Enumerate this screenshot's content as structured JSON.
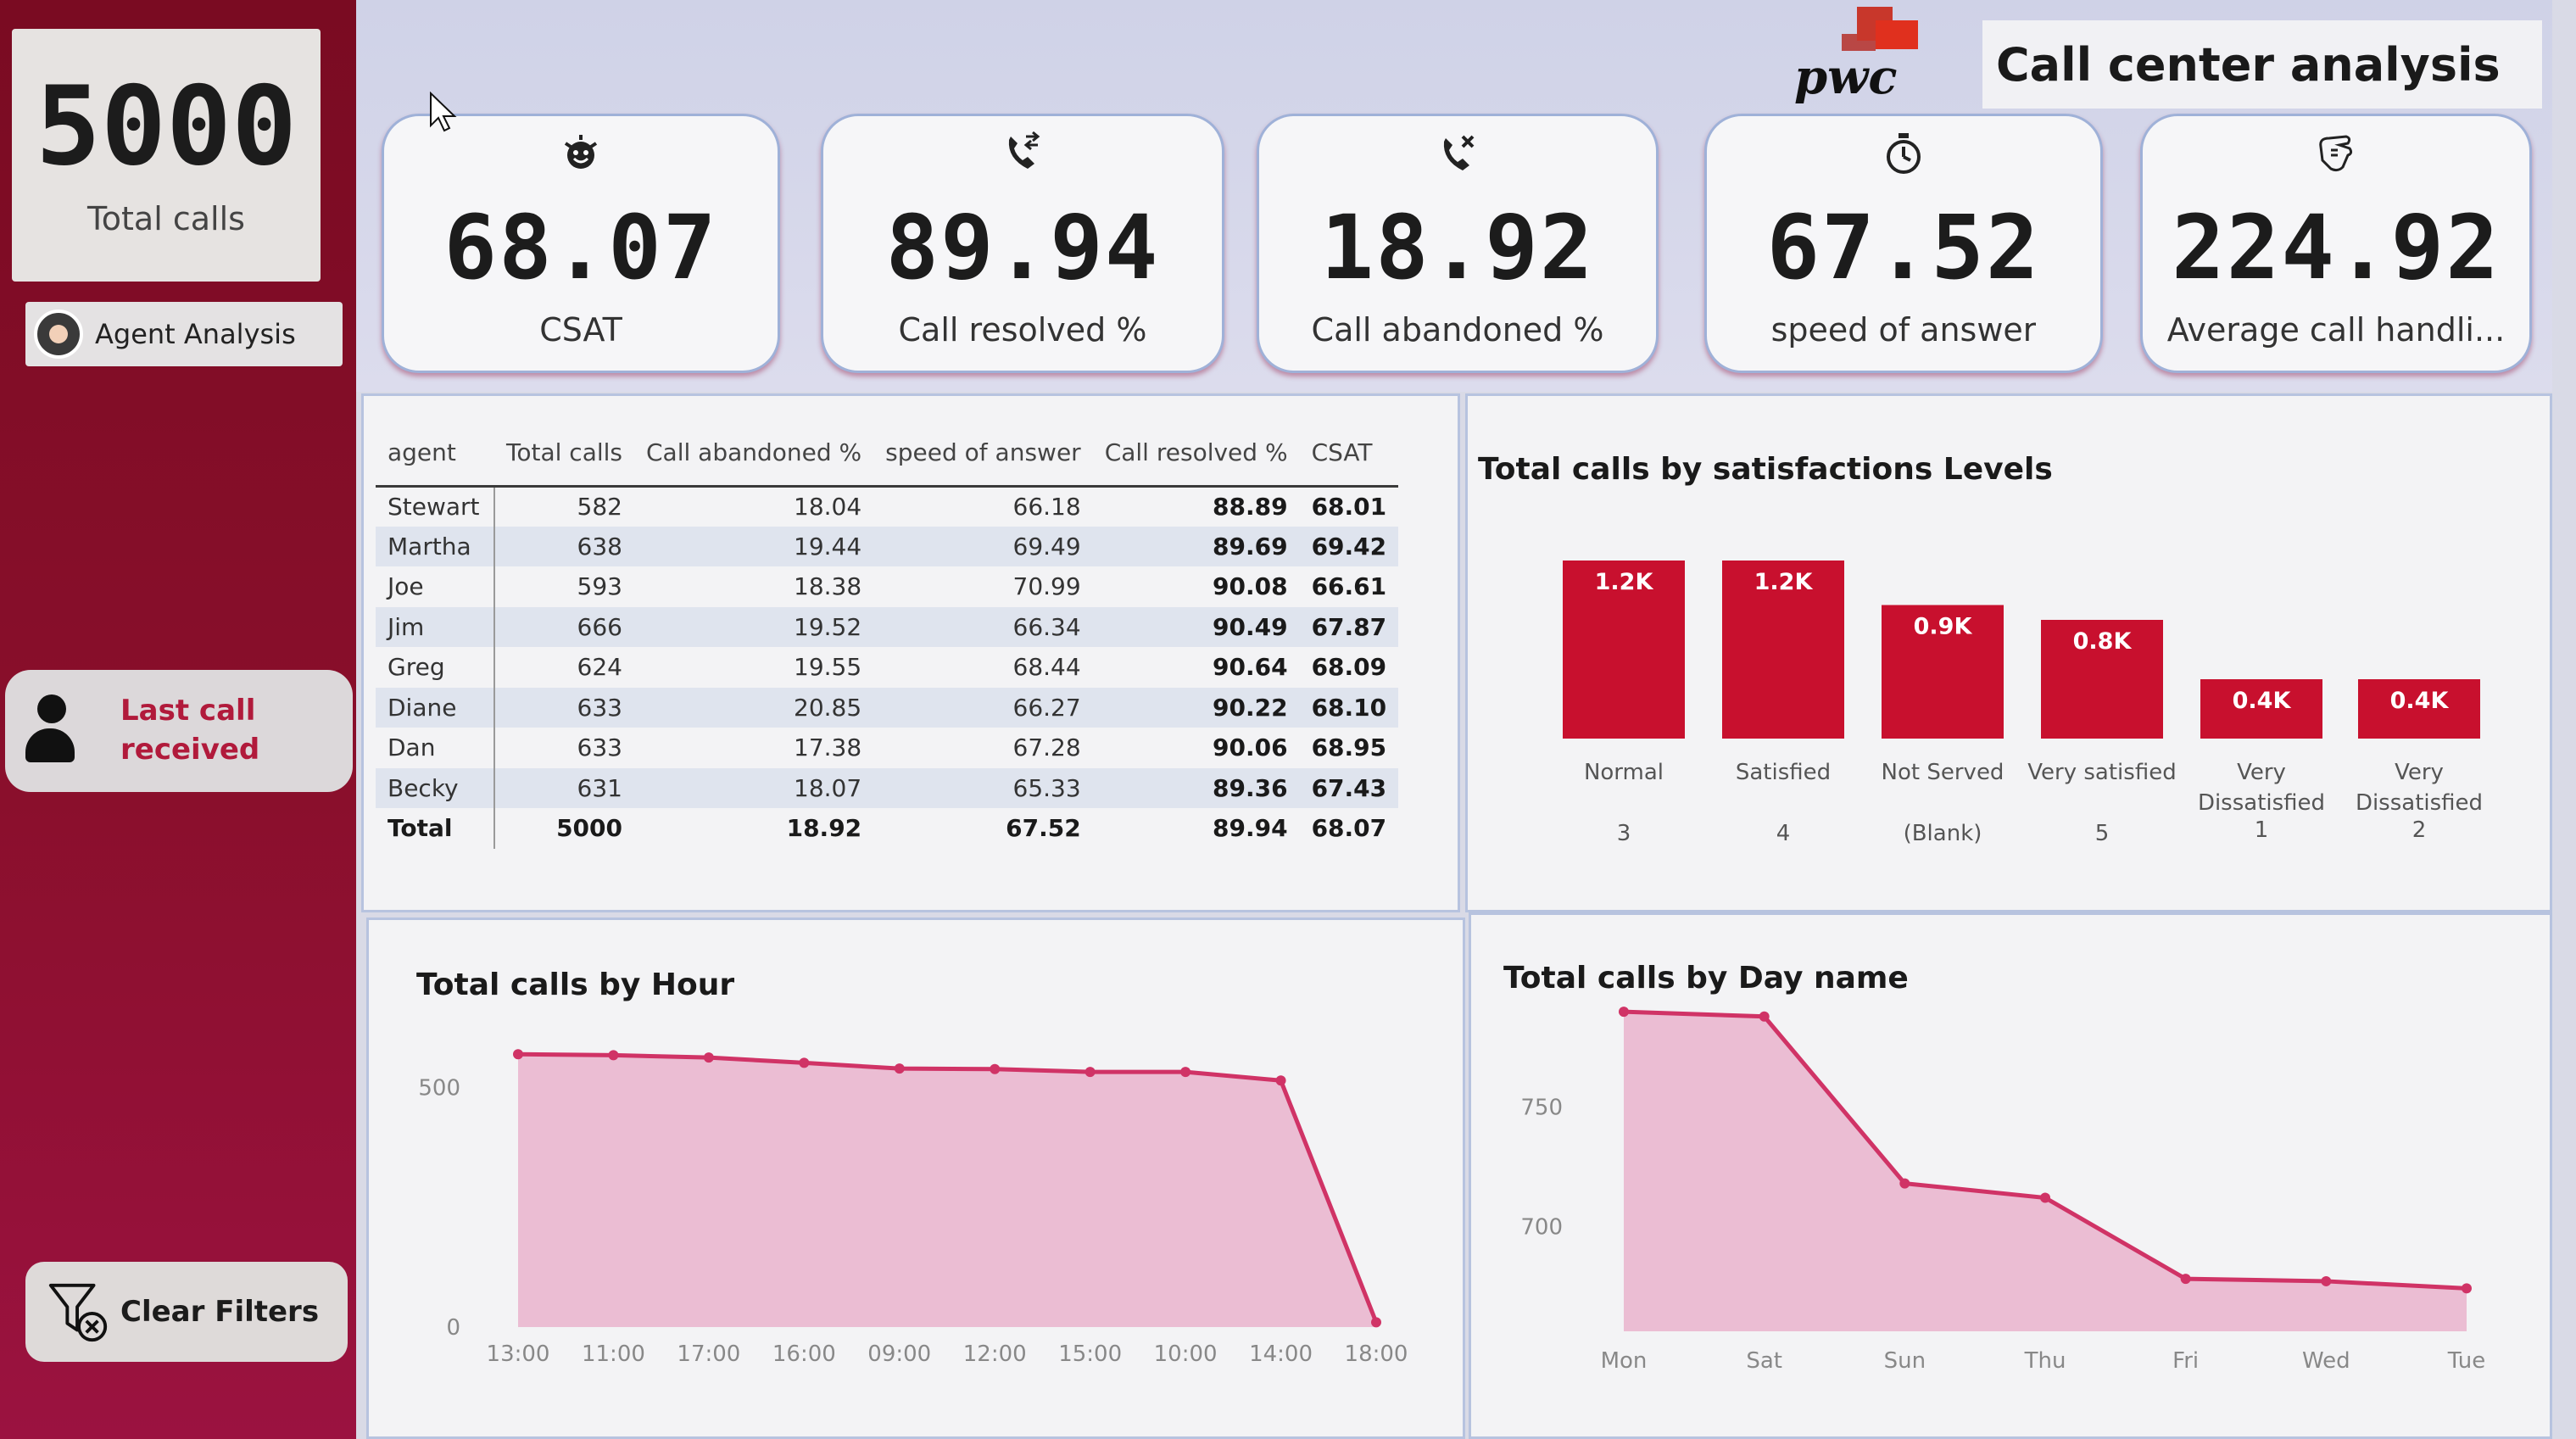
{
  "sidebar": {
    "total_calls": "5000",
    "total_calls_label": "Total calls",
    "agent_analysis": "Agent Analysis",
    "last_call_line1": "Last call",
    "last_call_line2": "received",
    "clear_filters": "Clear Filters"
  },
  "header": {
    "logo_text": "pwc",
    "title": "Call center analysis"
  },
  "kpis": [
    {
      "value": "68.07",
      "label": "CSAT",
      "icon": "smiley-face-icon"
    },
    {
      "value": "89.94",
      "label": "Call resolved %",
      "icon": "phone-transfer-icon"
    },
    {
      "value": "18.92",
      "label": "Call abandoned %",
      "icon": "phone-missed-icon"
    },
    {
      "value": "67.52",
      "label": "speed of answer",
      "icon": "stopwatch-icon"
    },
    {
      "value": "224.92",
      "label": "Average call handli...",
      "icon": "hand-icon"
    }
  ],
  "agent_table": {
    "headers": [
      "agent",
      "Total calls",
      "Call abandoned %",
      "speed of answer",
      "Call resolved %",
      "CSAT"
    ],
    "rows": [
      [
        "Stewart",
        "582",
        "18.04",
        "66.18",
        "88.89",
        "68.01"
      ],
      [
        "Martha",
        "638",
        "19.44",
        "69.49",
        "89.69",
        "69.42"
      ],
      [
        "Joe",
        "593",
        "18.38",
        "70.99",
        "90.08",
        "66.61"
      ],
      [
        "Jim",
        "666",
        "19.52",
        "66.34",
        "90.49",
        "67.87"
      ],
      [
        "Greg",
        "624",
        "19.55",
        "68.44",
        "90.64",
        "68.09"
      ],
      [
        "Diane",
        "633",
        "20.85",
        "66.27",
        "90.22",
        "68.10"
      ],
      [
        "Dan",
        "633",
        "17.38",
        "67.28",
        "90.06",
        "68.95"
      ],
      [
        "Becky",
        "631",
        "18.07",
        "65.33",
        "89.36",
        "67.43"
      ]
    ],
    "total": [
      "Total",
      "5000",
      "18.92",
      "67.52",
      "89.94",
      "68.07"
    ]
  },
  "chart_data": [
    {
      "type": "bar",
      "title": "Total calls by satisfactions Levels",
      "categories": [
        "Normal",
        "Satisfied",
        "Not Served",
        "Very satisfied",
        "Very Dissatisfied",
        "Very Dissatisfied"
      ],
      "sub_labels": [
        "3",
        "4",
        "(Blank)",
        "5",
        "1",
        "2"
      ],
      "values": [
        1200,
        1200,
        900,
        800,
        400,
        400
      ],
      "data_labels": [
        "1.2K",
        "1.2K",
        "0.9K",
        "0.8K",
        "0.4K",
        "0.4K"
      ],
      "color": "#c8102e",
      "grid": false
    },
    {
      "type": "area",
      "title": "Total calls by Hour",
      "categories": [
        "13:00",
        "11:00",
        "17:00",
        "16:00",
        "09:00",
        "12:00",
        "15:00",
        "10:00",
        "14:00",
        "18:00"
      ],
      "values": [
        570,
        568,
        563,
        552,
        540,
        539,
        533,
        533,
        515,
        10
      ],
      "y_ticks": [
        "0",
        "500"
      ],
      "ylim": [
        0,
        620
      ],
      "color": "#d03366"
    },
    {
      "type": "area",
      "title": "Total calls by Day name",
      "categories": [
        "Mon",
        "Sat",
        "Sun",
        "Thu",
        "Fri",
        "Wed",
        "Tue"
      ],
      "values": [
        790,
        788,
        718,
        712,
        678,
        677,
        674
      ],
      "y_ticks": [
        "700",
        "750"
      ],
      "ylim": [
        656,
        800
      ],
      "color": "#d03366"
    }
  ]
}
